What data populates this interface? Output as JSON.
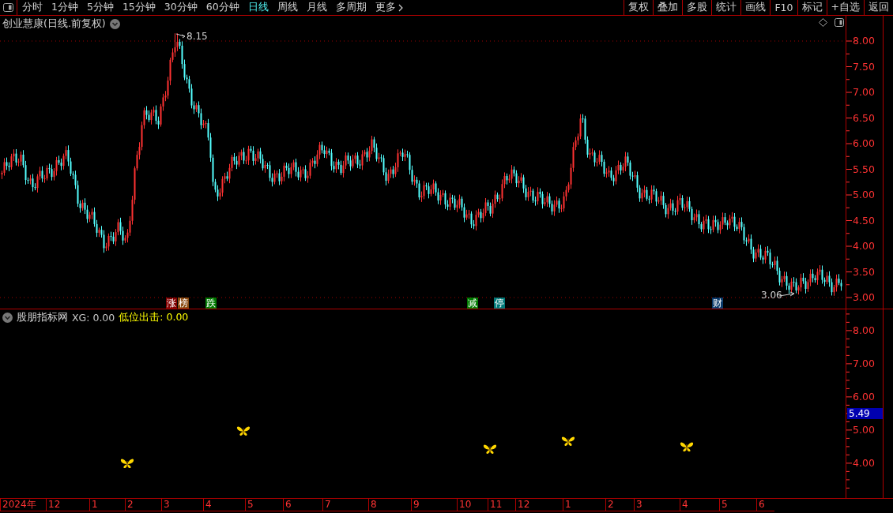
{
  "toolbar": {
    "periods": [
      {
        "label": "分时",
        "selected": false
      },
      {
        "label": "1分钟",
        "selected": false
      },
      {
        "label": "5分钟",
        "selected": false
      },
      {
        "label": "15分钟",
        "selected": false
      },
      {
        "label": "30分钟",
        "selected": false
      },
      {
        "label": "60分钟",
        "selected": false
      },
      {
        "label": "日线",
        "selected": true
      },
      {
        "label": "周线",
        "selected": false
      },
      {
        "label": "月线",
        "selected": false
      },
      {
        "label": "多周期",
        "selected": false
      }
    ],
    "more": "更多",
    "buttons": [
      "复权",
      "叠加",
      "多股",
      "统计",
      "画线",
      "F10",
      "标记",
      "+自选",
      "返回"
    ]
  },
  "main_chart": {
    "title": "创业慧康(日线.前复权)",
    "price_ticks": [
      "8.00",
      "7.50",
      "7.00",
      "6.50",
      "6.00",
      "5.50",
      "5.00",
      "4.50",
      "4.00",
      "3.50",
      "3.00"
    ],
    "high_label": "8.15",
    "low_label": "3.06",
    "events": [
      {
        "label": "涨",
        "color": "#800000"
      },
      {
        "label": "榜",
        "color": "#8a4a10"
      },
      {
        "label": "跌",
        "color": "#007a00"
      },
      {
        "label": "减",
        "color": "#007a00"
      },
      {
        "label": "停",
        "color": "#007878"
      },
      {
        "label": "财",
        "color": "#0a3a6a"
      }
    ]
  },
  "indicator": {
    "title": "股朋指标网",
    "legend": [
      {
        "label": "XG: 0.00",
        "color": "#c8c8c8"
      },
      {
        "label": "低位出击: 0.00",
        "color": "#ffff00"
      }
    ],
    "current_value": "5.49",
    "price_ticks": [
      "8.00",
      "7.00",
      "6.00",
      "5.00",
      "4.00"
    ],
    "signals": [
      {
        "kind": "butterfly"
      },
      {
        "kind": "butterfly"
      },
      {
        "kind": "butterfly"
      },
      {
        "kind": "butterfly"
      },
      {
        "kind": "butterfly"
      }
    ]
  },
  "time_axis": {
    "labels": [
      "2024年",
      "12",
      "1",
      "2",
      "3",
      "4",
      "5",
      "6",
      "7",
      "8",
      "9",
      "10",
      "11",
      "12",
      "1",
      "2",
      "3",
      "4",
      "5",
      "6"
    ]
  }
}
